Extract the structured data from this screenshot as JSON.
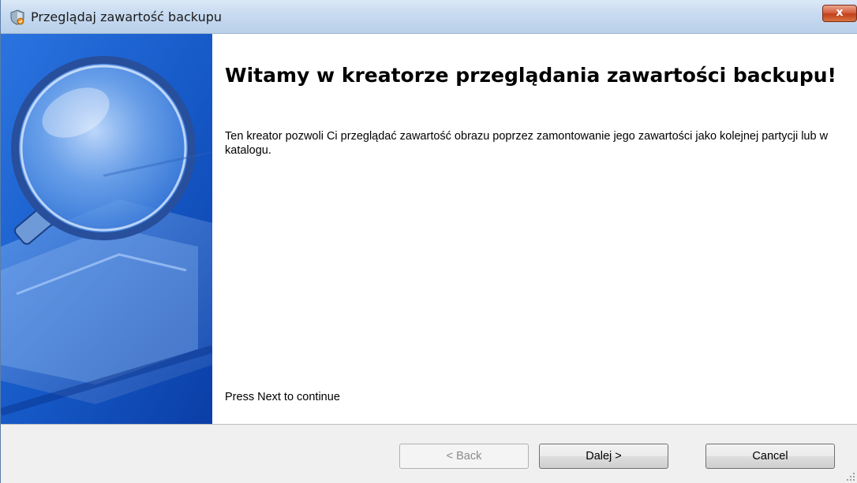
{
  "window": {
    "title": "Przeglądaj zawartość backupu",
    "title_icon": "backup-shield-icon",
    "close_label": "x"
  },
  "content": {
    "heading": "Witamy w kreatorze przeglądania zawartości backupu!",
    "description": "Ten kreator pozwoli Ci przeglądać zawartość obrazu poprzez zamontowanie jego zawartości jako kolejnej partycji lub w katalogu.",
    "hint": "Press Next to continue"
  },
  "buttons": {
    "back": "< Back",
    "next": "Dalej >",
    "cancel": "Cancel"
  },
  "colors": {
    "side_panel_blue": "#1a5fd0",
    "titlebar": "#c7daf0",
    "footer": "#f0f0f0",
    "close_red": "#c2401c"
  }
}
